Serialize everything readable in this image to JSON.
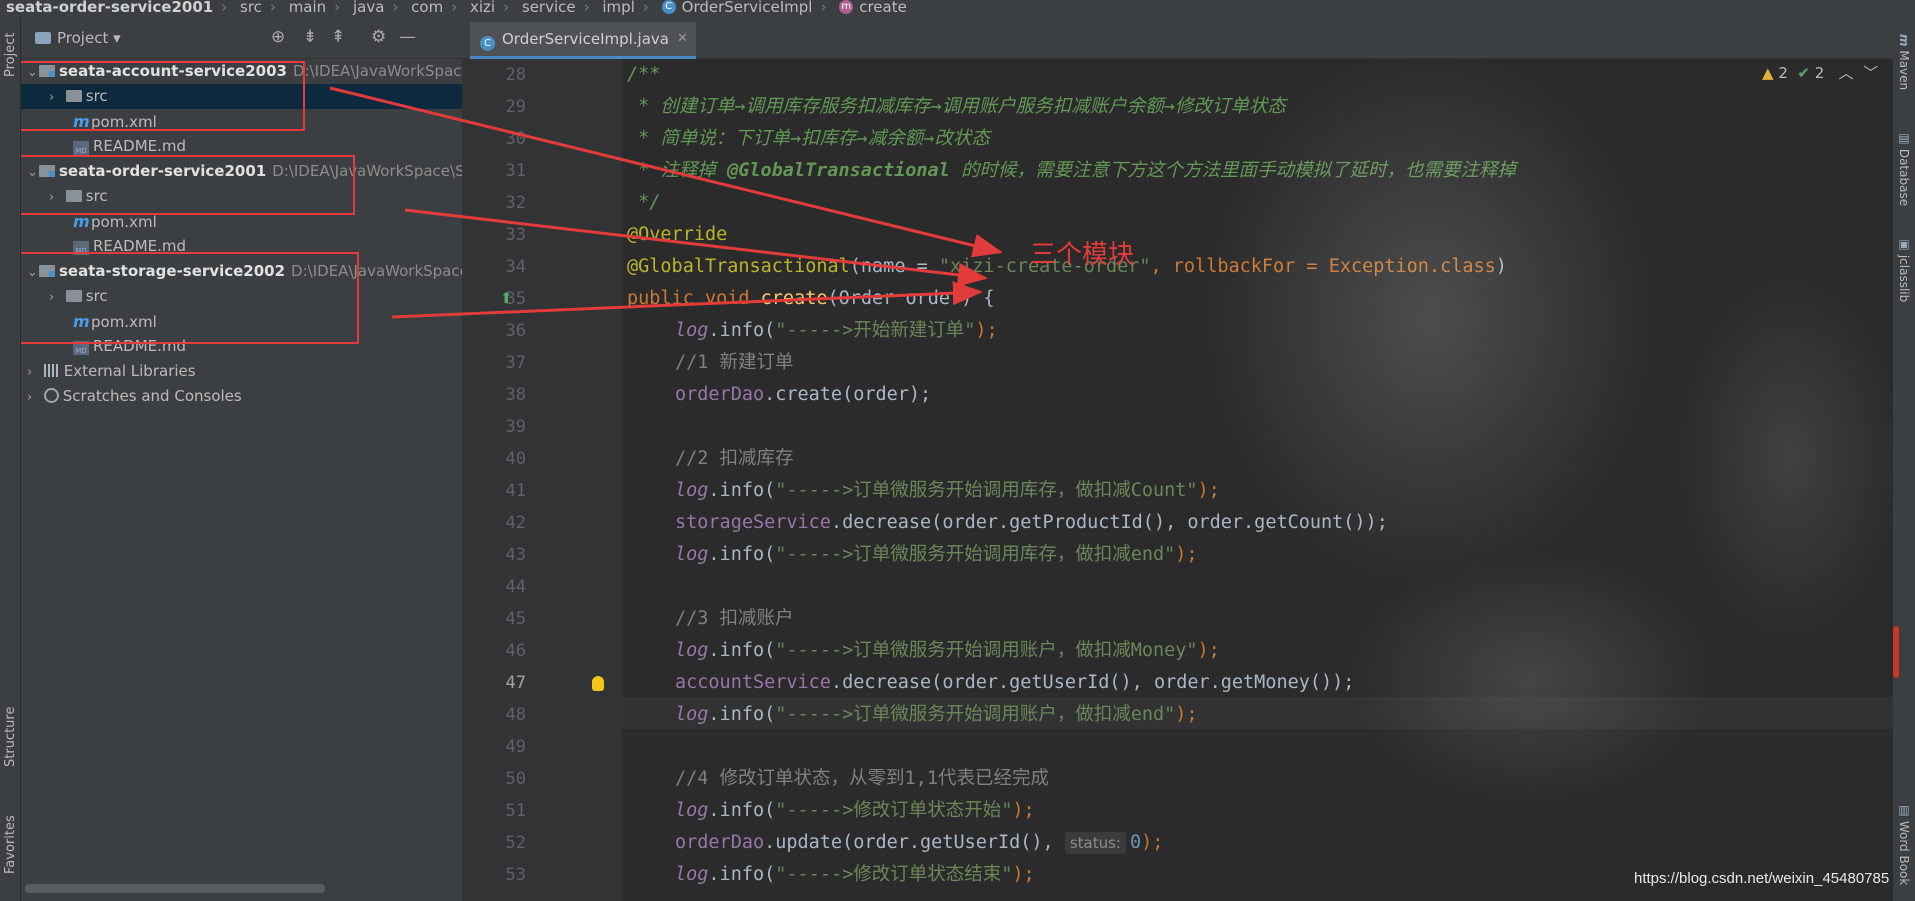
{
  "breadcrumb": {
    "project": "seata-order-service2001",
    "parts": [
      "src",
      "main",
      "java",
      "com",
      "xizi",
      "service",
      "impl",
      "OrderServiceImpl"
    ],
    "method": "create"
  },
  "project_panel": {
    "title": "Project",
    "tree": [
      {
        "name": "seata-account-service2003",
        "path": "D:\\IDEA\\JavaWorkSpace\\"
      },
      {
        "name": "src"
      },
      {
        "name": "pom.xml"
      },
      {
        "name": "README.md"
      },
      {
        "name": "seata-order-service2001",
        "path": "D:\\IDEA\\JavaWorkSpace\\Se"
      },
      {
        "name": "src"
      },
      {
        "name": "pom.xml"
      },
      {
        "name": "README.md"
      },
      {
        "name": "seata-storage-service2002",
        "path": "D:\\IDEA\\JavaWorkSpace\\"
      },
      {
        "name": "src"
      },
      {
        "name": "pom.xml"
      },
      {
        "name": "README.md"
      },
      {
        "name": "External Libraries"
      },
      {
        "name": "Scratches and Consoles"
      }
    ]
  },
  "left_tabs": {
    "project": "Project",
    "structure": "Structure",
    "favorites": "Favorites"
  },
  "right_tabs": {
    "maven": "Maven",
    "database": "Database",
    "jclasslib": "jclasslib",
    "word_book": "Word Book"
  },
  "editor": {
    "tab_label": "OrderServiceImpl.java",
    "inspections": {
      "warnings": "2",
      "ok": "2"
    },
    "line_numbers": [
      "28",
      "29",
      "30",
      "31",
      "32",
      "33",
      "34",
      "35",
      "36",
      "37",
      "38",
      "39",
      "40",
      "41",
      "42",
      "43",
      "44",
      "45",
      "46",
      "47",
      "48",
      "49",
      "50",
      "51",
      "52",
      "53"
    ],
    "active_line": "47",
    "code": {
      "l28": "/**",
      "l29": " * 创建订单→调用库存服务扣减库存→调用账户服务扣减账户余额→修改订单状态",
      "l30": " * 简单说：下订单→扣库存→减余额→改状态",
      "l31_a": " * 注释掉 ",
      "l31_b": "@GlobalTransactional",
      "l31_c": " 的时候，需要注意下方这个方法里面手动模拟了延时，也需要注释掉",
      "l32": " */",
      "l33": "@Override",
      "l34_a": "@GlobalTransactional",
      "l34_b": "(name = ",
      "l34_c": "\"xizi-create-order\"",
      "l34_d": ", rollbackFor = Exception.",
      "l34_e": "class",
      "l34_f": ")",
      "l35_a": "public void ",
      "l35_b": "create",
      "l35_c": "(Order order) {",
      "log": "log",
      "info_open": ".info(",
      "close_semi": ");",
      "l36_str": "\"----->开始新建订单\"",
      "l37": "//1 新建订单",
      "l38_a": "orderDao",
      "l38_b": ".create(order);",
      "l40": "//2 扣减库存",
      "l41_str": "\"----->订单微服务开始调用库存，做扣减Count\"",
      "l42_a": "storageService",
      "l42_b": ".decrease(order.getProductId(), order.getCount());",
      "l43_str": "\"----->订单微服务开始调用库存，做扣减end\"",
      "l45": "//3 扣减账户",
      "l46_str": "\"----->订单微服务开始调用账户，做扣减Money\"",
      "l47_a": "accountService",
      "l47_b": ".decrease(order.getUserId(), order.getMoney());",
      "l48_str": "\"----->订单微服务开始调用账户，做扣减end\"",
      "l50": "//4 修改订单状态，从零到1,1代表已经完成",
      "l51_str": "\"----->修改订单状态开始\"",
      "l52_a": "orderDao",
      "l52_b": ".update(order.getUserId(), ",
      "l52_hint": "status:",
      "l52_num": "0",
      "l53_str": "\"----->修改订单状态结束\""
    }
  },
  "annotation": {
    "label": "三个模块",
    "color": "#e23b3b"
  },
  "watermark": "https://blog.csdn.net/weixin_45480785",
  "colors": {
    "keyword": "#cc7832",
    "string": "#6a8759",
    "comment": "#629755",
    "annotation": "#bbb529",
    "method": "#ffc66d",
    "field": "#9876aa"
  }
}
